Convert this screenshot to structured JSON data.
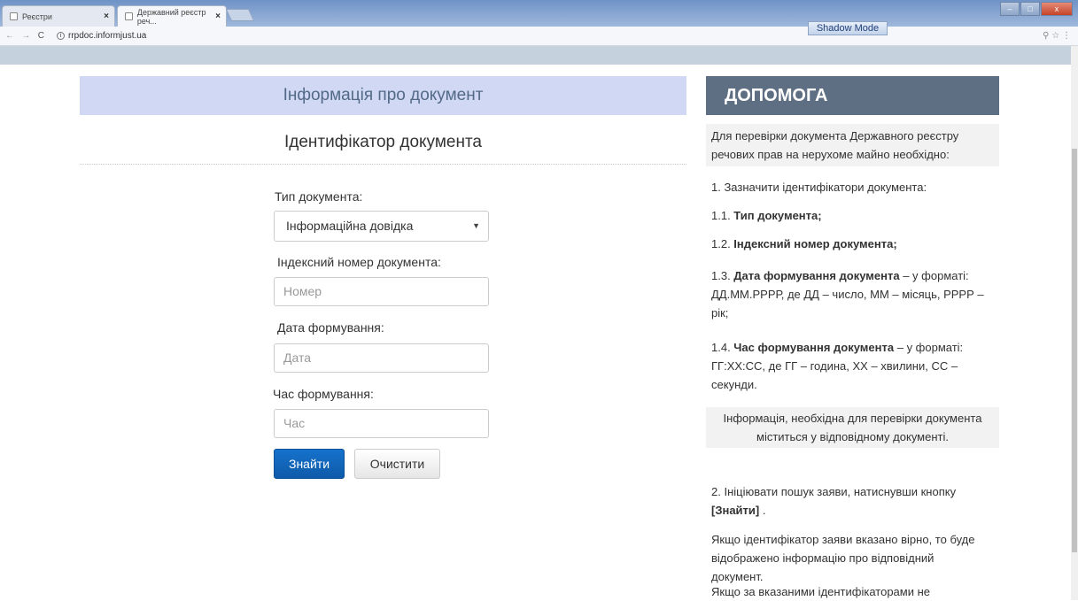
{
  "browser": {
    "tabs": [
      {
        "label": "Реєстри"
      },
      {
        "label": "Державний реєстр реч..."
      }
    ],
    "url": "rrpdoc.informjust.ua",
    "shadow_mode": "Shadow Mode"
  },
  "form": {
    "header": "Інформація про документ",
    "subtitle": "Ідентифікатор документа",
    "doc_type_label": "Тип документа:",
    "doc_type_value": "Інформаційна довідка",
    "index_label": "Індексний номер документа:",
    "index_placeholder": "Номер",
    "date_label": "Дата формування:",
    "date_placeholder": "Дата",
    "time_label": "Час формування:",
    "time_placeholder": "Час",
    "find_button": "Знайти",
    "clear_button": "Очистити"
  },
  "help": {
    "title": "ДОПОМОГА",
    "intro": "Для перевірки документа Державного реєстру речових прав на нерухоме майно необхідно:",
    "step1": "1. Зазначити ідентифікатори документа:",
    "s11_prefix": "1.1. ",
    "s11_bold": "Тип документа;",
    "s12_prefix": "1.2. ",
    "s12_bold": "Індексний номер документа;",
    "s13_prefix": "1.3. ",
    "s13_bold": "Дата формування документа",
    "s13_rest": " – у форматі: ДД.ММ.РРРР, де ДД – число, ММ – місяць, РРРР – рік;",
    "s14_prefix": "1.4. ",
    "s14_bold": "Час формування документа",
    "s14_rest": " – у форматі: ГГ:ХХ:СС, де ГГ – година, ХХ – хвилини, СС – секунди.",
    "note": "Інформація, необхідна для перевірки документа міститься у відповідному документі.",
    "step2_text": "2. Ініціювати пошук заяви, натиснувши кнопку ",
    "step2_bold": "[Знайти]",
    "step2_end": " .",
    "p_correct": "Якщо ідентифікатор заяви вказано вірно, то буде відображено інформацію про відповідний документ.",
    "p_incorrect": "Якщо за вказаними ідентифікаторами не"
  }
}
